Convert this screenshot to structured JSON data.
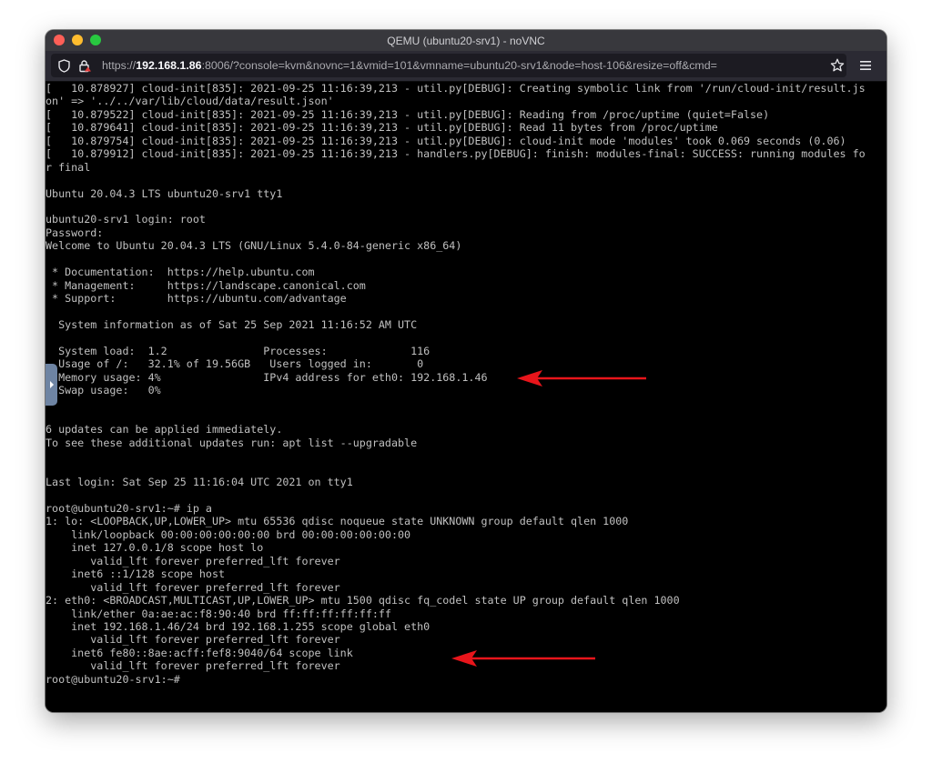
{
  "window": {
    "title": "QEMU (ubuntu20-srv1) - noVNC"
  },
  "browser": {
    "url_scheme": "https://",
    "url_host": "192.168.1.86",
    "url_rest": ":8006/?console=kvm&novnc=1&vmid=101&vmname=ubuntu20-srv1&node=host-106&resize=off&cmd=",
    "icons": [
      "shield-icon",
      "lock-icon",
      "bookmark-star-icon",
      "hamburger-menu-icon"
    ]
  },
  "console": {
    "lines": [
      "[   10.878927] cloud-init[835]: 2021-09-25 11:16:39,213 - util.py[DEBUG]: Creating symbolic link from '/run/cloud-init/result.js",
      "on' => '../../var/lib/cloud/data/result.json'",
      "[   10.879522] cloud-init[835]: 2021-09-25 11:16:39,213 - util.py[DEBUG]: Reading from /proc/uptime (quiet=False)",
      "[   10.879641] cloud-init[835]: 2021-09-25 11:16:39,213 - util.py[DEBUG]: Read 11 bytes from /proc/uptime",
      "[   10.879754] cloud-init[835]: 2021-09-25 11:16:39,213 - util.py[DEBUG]: cloud-init mode 'modules' took 0.069 seconds (0.06)",
      "[   10.879912] cloud-init[835]: 2021-09-25 11:16:39,213 - handlers.py[DEBUG]: finish: modules-final: SUCCESS: running modules fo",
      "r final",
      "",
      "Ubuntu 20.04.3 LTS ubuntu20-srv1 tty1",
      "",
      "ubuntu20-srv1 login: root",
      "Password:",
      "Welcome to Ubuntu 20.04.3 LTS (GNU/Linux 5.4.0-84-generic x86_64)",
      "",
      " * Documentation:  https://help.ubuntu.com",
      " * Management:     https://landscape.canonical.com",
      " * Support:        https://ubuntu.com/advantage",
      "",
      "  System information as of Sat 25 Sep 2021 11:16:52 AM UTC",
      "",
      "  System load:  1.2               Processes:             116",
      "  Usage of /:   32.1% of 19.56GB   Users logged in:       0",
      "  Memory usage: 4%                IPv4 address for eth0: 192.168.1.46",
      "  Swap usage:   0%",
      "",
      "",
      "6 updates can be applied immediately.",
      "To see these additional updates run: apt list --upgradable",
      "",
      "",
      "Last login: Sat Sep 25 11:16:04 UTC 2021 on tty1",
      "",
      "root@ubuntu20-srv1:~# ip a",
      "1: lo: <LOOPBACK,UP,LOWER_UP> mtu 65536 qdisc noqueue state UNKNOWN group default qlen 1000",
      "    link/loopback 00:00:00:00:00:00 brd 00:00:00:00:00:00",
      "    inet 127.0.0.1/8 scope host lo",
      "       valid_lft forever preferred_lft forever",
      "    inet6 ::1/128 scope host",
      "       valid_lft forever preferred_lft forever",
      "2: eth0: <BROADCAST,MULTICAST,UP,LOWER_UP> mtu 1500 qdisc fq_codel state UP group default qlen 1000",
      "    link/ether 0a:ae:ac:f8:90:40 brd ff:ff:ff:ff:ff:ff",
      "    inet 192.168.1.46/24 brd 192.168.1.255 scope global eth0",
      "       valid_lft forever preferred_lft forever",
      "    inet6 fe80::8ae:acff:fef8:9040/64 scope link",
      "       valid_lft forever preferred_lft forever",
      "root@ubuntu20-srv1:~#"
    ]
  },
  "colors": {
    "terminal_bg": "#000000",
    "terminal_fg": "#c0c0c0",
    "annotation_arrow": "#e8151b"
  }
}
